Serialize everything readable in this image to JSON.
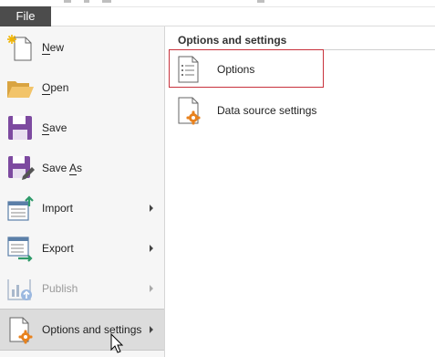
{
  "file_tab": {
    "label": "File"
  },
  "menu": {
    "items": [
      {
        "label_pre": "",
        "label_u": "N",
        "label_post": "ew",
        "icon": "new-file-icon"
      },
      {
        "label_pre": "",
        "label_u": "O",
        "label_post": "pen",
        "icon": "open-folder-icon"
      },
      {
        "label_pre": "",
        "label_u": "S",
        "label_post": "ave",
        "icon": "save-icon"
      },
      {
        "label_pre": "Save ",
        "label_u": "A",
        "label_post": "s",
        "icon": "save-as-icon"
      },
      {
        "label": "Import",
        "icon": "import-icon",
        "has_submenu": true
      },
      {
        "label": "Export",
        "icon": "export-icon",
        "has_submenu": true
      },
      {
        "label": "Publish",
        "icon": "publish-icon",
        "has_submenu": true,
        "disabled": true
      },
      {
        "label": "Options and settings",
        "icon": "options-settings-icon",
        "has_submenu": true,
        "selected": true
      }
    ]
  },
  "submenu": {
    "title": "Options and settings",
    "items": [
      {
        "label": "Options",
        "icon": "options-list-icon",
        "highlighted": true
      },
      {
        "label": "Data source settings",
        "icon": "data-source-settings-icon"
      }
    ]
  },
  "colors": {
    "file_tab": "#4c4c4c",
    "menu_bg": "#f6f6f6",
    "selected_bg": "#dcdcdc",
    "highlight_border": "#c8323c",
    "accent_orange": "#e8821e",
    "save_purple": "#7d4aa0"
  }
}
